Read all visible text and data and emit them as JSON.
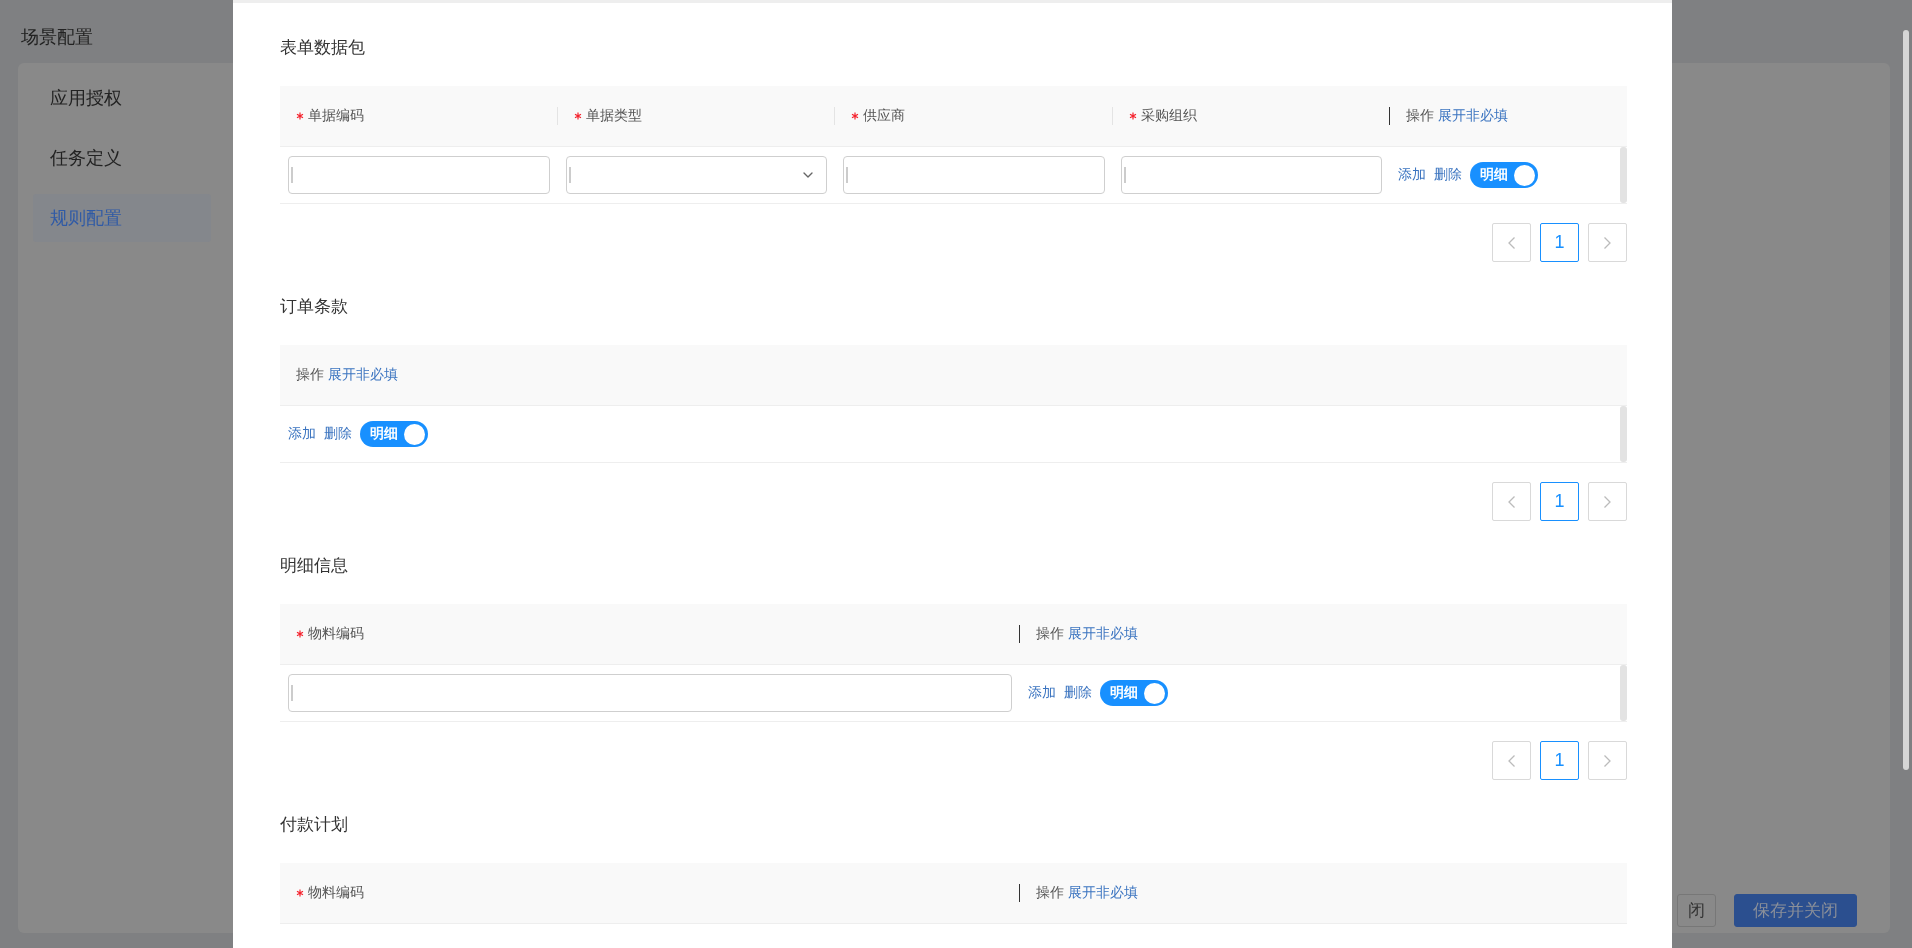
{
  "page": {
    "title": "场景配置"
  },
  "sidebar": {
    "items": [
      {
        "label": "应用授权",
        "selected": false
      },
      {
        "label": "任务定义",
        "selected": false
      },
      {
        "label": "规则配置",
        "selected": true
      }
    ]
  },
  "footer_buttons": [
    {
      "label": "闭",
      "kind": "default"
    },
    {
      "label": "保存并关闭",
      "kind": "primary"
    }
  ],
  "modal": {
    "sections": [
      {
        "title": "表单数据包",
        "columns": [
          {
            "label": "单据编码",
            "required": true,
            "kind": "text"
          },
          {
            "label": "单据类型",
            "required": true,
            "kind": "select"
          },
          {
            "label": "供应商",
            "required": true,
            "kind": "text"
          },
          {
            "label": "采购组织",
            "required": true,
            "kind": "text"
          }
        ],
        "actions_header": {
          "label": "操作",
          "link": "展开非必填"
        },
        "rows": [
          {
            "add": "添加",
            "delete": "删除",
            "toggle": {
              "label": "明细",
              "on": true
            }
          }
        ],
        "pagination": {
          "pages": [
            {
              "label": "1",
              "selected": true
            }
          ]
        }
      },
      {
        "title": "订单条款",
        "actions_header": {
          "label": "操作",
          "link": "展开非必填"
        },
        "rows": [
          {
            "add": "添加",
            "delete": "删除",
            "toggle": {
              "label": "明细",
              "on": true
            }
          }
        ],
        "pagination": {
          "pages": [
            {
              "label": "1",
              "selected": true
            }
          ]
        }
      },
      {
        "title": "明细信息",
        "columns": [
          {
            "label": "物料编码",
            "required": true,
            "kind": "text"
          }
        ],
        "actions_header": {
          "label": "操作",
          "link": "展开非必填"
        },
        "rows": [
          {
            "add": "添加",
            "delete": "删除",
            "toggle": {
              "label": "明细",
              "on": true
            }
          }
        ],
        "pagination": {
          "pages": [
            {
              "label": "1",
              "selected": true
            }
          ]
        }
      },
      {
        "title": "付款计划",
        "columns": [
          {
            "label": "物料编码",
            "required": true
          }
        ],
        "actions_header": {
          "label": "操作",
          "link": "展开非必填"
        }
      }
    ]
  }
}
